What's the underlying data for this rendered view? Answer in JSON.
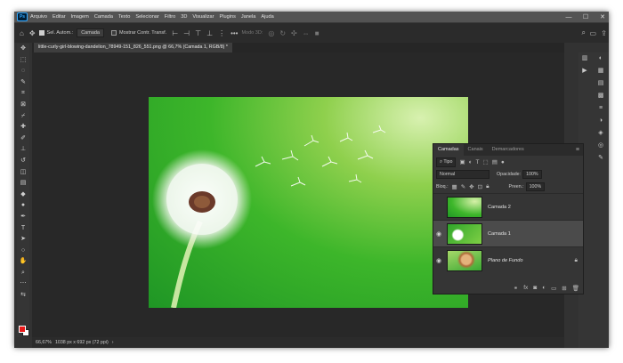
{
  "app": {
    "logo": "Ps",
    "menu": [
      "Arquivo",
      "Editar",
      "Imagem",
      "Camada",
      "Texto",
      "Selecionar",
      "Filtro",
      "3D",
      "Visualizar",
      "Plugins",
      "Janela",
      "Ajuda"
    ],
    "window_controls": [
      "—",
      "☐",
      "✕"
    ]
  },
  "options": {
    "auto_select_label": "Sel. Autom.:",
    "auto_select_target": "Camada",
    "show_transform_label": "Mostrar Contr. Transf.",
    "mode_3d_label": "Modo 3D:",
    "more_label": "•••"
  },
  "document": {
    "tab_title": "little-curly-girl-blowing-dandelion_78949-151_826_551.png @ 66,7% (Camada 1, RGB/8) *"
  },
  "status": {
    "zoom": "66,67%",
    "doc_info": "1038 px x 692 px (72 ppi)",
    "arrow": "›"
  },
  "colors": {
    "foreground": "#e81919",
    "background": "#ffffff",
    "accent": "#31a8ff"
  },
  "layers_panel": {
    "tabs": [
      "Camadas",
      "Canais",
      "Demarcadores"
    ],
    "kind_filter": "Tipo",
    "blend_mode": "Normal",
    "opacity_label": "Opacidade:",
    "opacity_value": "100%",
    "lock_label": "Bloq.:",
    "fill_label": "Preen.:",
    "fill_value": "100%",
    "layers": [
      {
        "name": "Camada 2",
        "visible": false,
        "selected": false,
        "italic": false
      },
      {
        "name": "Camada 1",
        "visible": true,
        "selected": true,
        "italic": false
      },
      {
        "name": "Plano de Fundo",
        "visible": true,
        "selected": false,
        "italic": true,
        "locked": true
      }
    ]
  }
}
